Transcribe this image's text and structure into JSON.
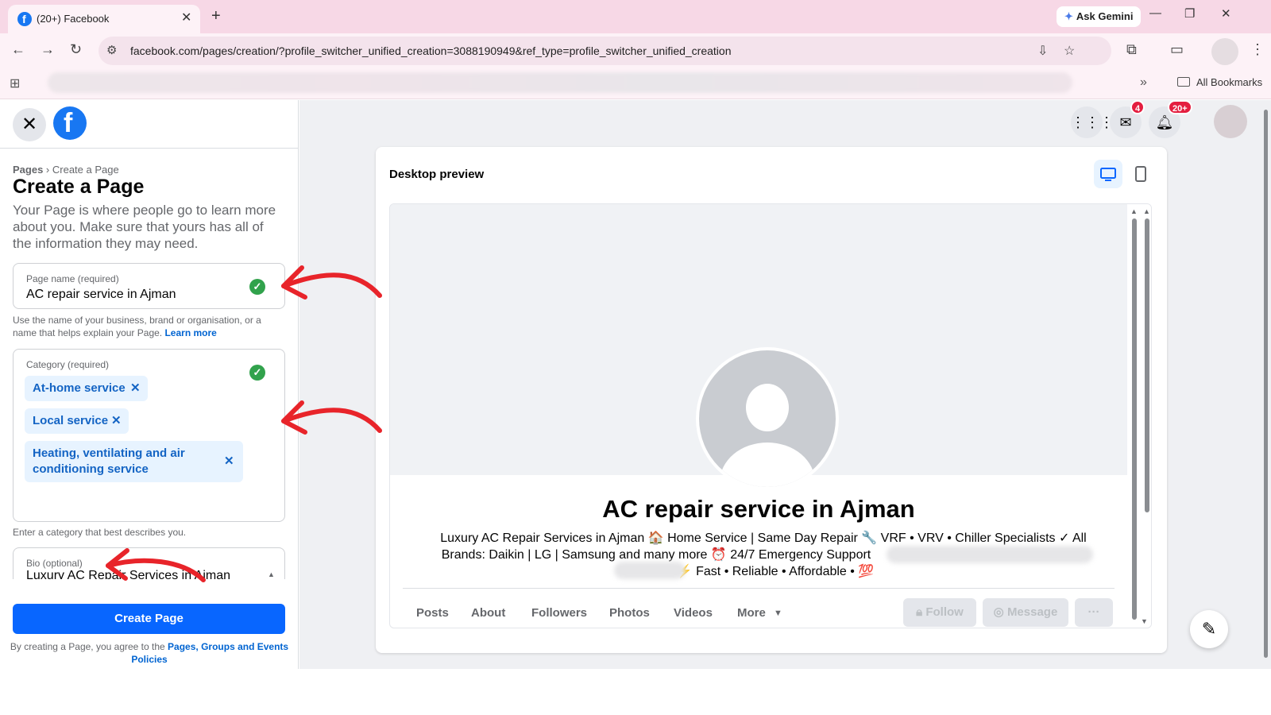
{
  "browser": {
    "tab_title": "(20+) Facebook",
    "tab_close": "✕",
    "new_tab": "+",
    "ask_gemini": "Ask Gemini",
    "url": "facebook.com/pages/creation/?profile_switcher_unified_creation=3088190949&ref_type=profile_switcher_unified_creation",
    "all_bookmarks": "All Bookmarks",
    "back": "←",
    "forward": "→",
    "reload": "↻",
    "minimize": "—",
    "restore": "❐",
    "close": "✕"
  },
  "panel": {
    "breadcrumb_root": "Pages",
    "breadcrumb_sep": " › ",
    "breadcrumb_current": "Create a Page",
    "title": "Create a Page",
    "intro": "Your Page is where people go to learn more about you. Make sure that yours has all of the information they may need.",
    "page_name": {
      "label": "Page name (required)",
      "value": "AC repair service in Ajman",
      "hint": "Use the name of your business, brand or organisation, or a name that helps explain your Page.",
      "learn_more": "Learn more"
    },
    "category": {
      "label": "Category (required)",
      "chips": [
        "At-home service",
        "Local service",
        "Heating, ventilating and air conditioning service"
      ],
      "hint": "Enter a category that best describes you."
    },
    "bio": {
      "label": "Bio (optional)",
      "value": "Luxury AC Repair Services in Ajman"
    },
    "create_button": "Create Page",
    "policy_prefix": "By creating a Page, you agree to the",
    "policy_link": "Pages, Groups and Events Policies"
  },
  "header_icons": {
    "messenger_badge": "4",
    "notifications_badge": "20+"
  },
  "preview": {
    "title": "Desktop preview",
    "page_name": "AC repair service in Ajman",
    "bio_line1": "Luxury AC Repair Services in Ajman 🏠 Home Service | Same Day Repair 🔧 VRF • VRV • Chiller Specialists ✓ All",
    "bio_line2": "Brands: Daikin | LG | Samsung and many more ⏰ 24/7 Emergency Support",
    "bio_line3": "⚡ Fast • Reliable • Affordable • 💯",
    "tabs": [
      "Posts",
      "About",
      "Followers",
      "Photos",
      "Videos",
      "More"
    ],
    "follow": "Follow",
    "message": "Message",
    "more_dots": "···"
  },
  "colors": {
    "facebook_blue": "#0866ff",
    "check_green": "#31a24c",
    "annotation_red": "#e8242a",
    "badge_red": "#e41e3f"
  }
}
